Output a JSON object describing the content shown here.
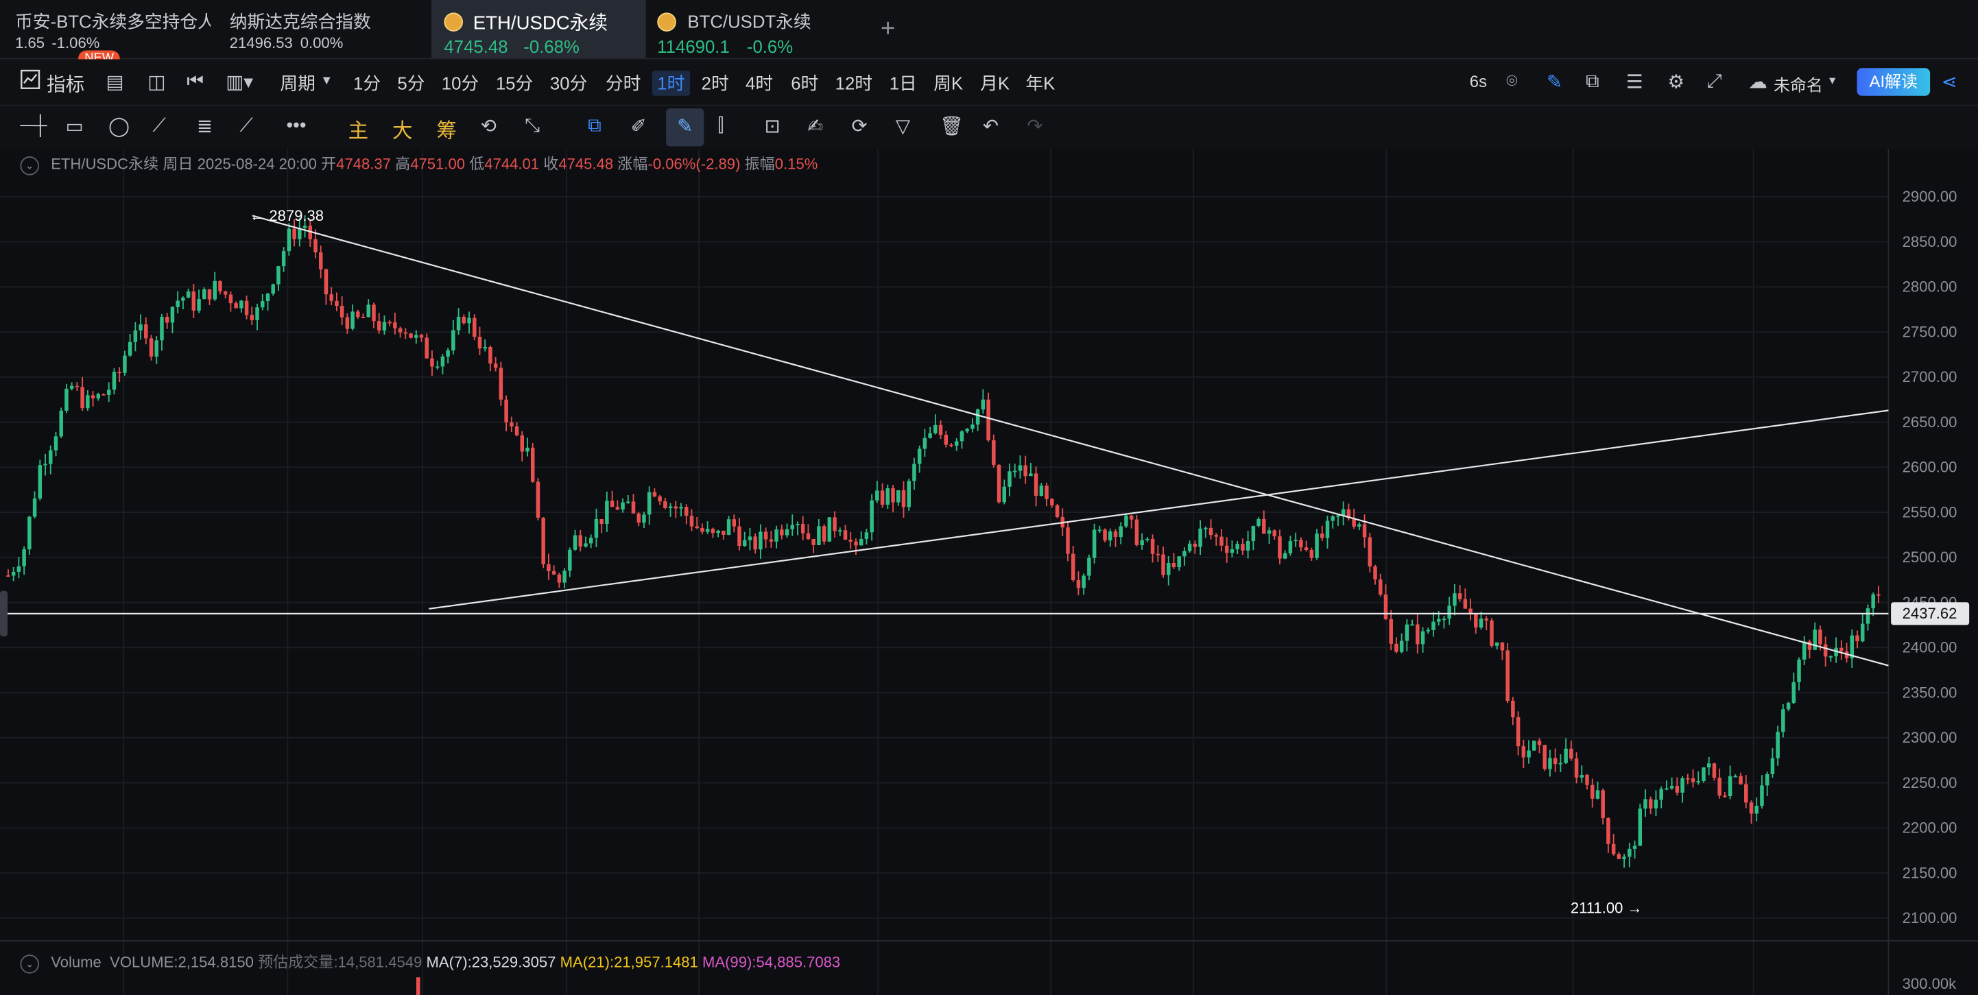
{
  "tabs": [
    {
      "title": "币安-BTC永续多空持仓人数",
      "price": "1.65",
      "change": "-1.06%",
      "badge": "NEW"
    },
    {
      "title": "纳斯达克综合指数",
      "price": "21496.53",
      "change": "0.00%"
    },
    {
      "title": "ETH/USDC永续",
      "price": "4745.48",
      "change": "-0.68%",
      "active": true
    },
    {
      "title": "BTC/USDT永续",
      "price": "114690.1",
      "change": "-0.6%"
    }
  ],
  "toolbar": {
    "indicator": "指标",
    "period": "周期",
    "intervals": [
      "1分",
      "5分",
      "10分",
      "15分",
      "30分",
      "分时",
      "1时",
      "2时",
      "4时",
      "6时",
      "12时",
      "1日",
      "周K",
      "月K",
      "年K"
    ],
    "selected_interval": "1时",
    "refresh": "6s",
    "layout_name": "未命名",
    "ai_label": "AI解读"
  },
  "drawing_tools": {
    "main": "主",
    "big": "大",
    "chips": "筹"
  },
  "legend": {
    "symbol": "ETH/USDC永续",
    "period": "周日",
    "datetime": "2025-08-24 20:00",
    "open_label": "开",
    "open": "4748.37",
    "high_label": "高",
    "high": "4751.00",
    "low_label": "低",
    "low": "4744.01",
    "close_label": "收",
    "close": "4745.48",
    "chg_label": "涨幅",
    "chg": "-0.06%(-2.89)",
    "amp_label": "振幅",
    "amp": "0.15%"
  },
  "volume_legend": {
    "title": "Volume",
    "volume": "VOLUME:2,154.8150",
    "estimate": "预估成交量:14,581.4549",
    "ma7": "MA(7):23,529.3057",
    "ma21": "MA(21):21,957.1481",
    "ma99": "MA(99):54,885.7083"
  },
  "chart_data": {
    "type": "candlestick",
    "y_ticks": [
      "2900.00",
      "2850.00",
      "2800.00",
      "2750.00",
      "2700.00",
      "2650.00",
      "2600.00",
      "2550.00",
      "2500.00",
      "2450.00",
      "2400.00",
      "2350.00",
      "2300.00",
      "2250.00",
      "2200.00",
      "2150.00",
      "2100.00"
    ],
    "ylim": [
      2080,
      2920
    ],
    "volume_tick": "300.00k",
    "current_price": "2437.62",
    "high_annotation": "2879.38",
    "low_annotation": "2111.00",
    "close_path": [
      2480,
      2510,
      2600,
      2640,
      2690,
      2670,
      2680,
      2700,
      2760,
      2730,
      2770,
      2790,
      2780,
      2800,
      2790,
      2780,
      2770,
      2820,
      2860,
      2870,
      2800,
      2770,
      2760,
      2770,
      2750,
      2760,
      2740,
      2720,
      2730,
      2770,
      2740,
      2700,
      2640,
      2620,
      2500,
      2470,
      2520,
      2530,
      2550,
      2560,
      2540,
      2580,
      2560,
      2550,
      2530,
      2520,
      2540,
      2510,
      2520,
      2530,
      2550,
      2520,
      2530,
      2540,
      2500,
      2560,
      2570,
      2560,
      2620,
      2640,
      2630,
      2650,
      2670,
      2560,
      2600,
      2590,
      2560,
      2530,
      2470,
      2520,
      2530,
      2540,
      2520,
      2500,
      2480,
      2510,
      2530,
      2520,
      2510,
      2520,
      2540,
      2500,
      2520,
      2510,
      2530,
      2550,
      2540,
      2480,
      2400,
      2420,
      2410,
      2440,
      2450,
      2440,
      2420,
      2400,
      2280,
      2290,
      2270,
      2280,
      2260,
      2240,
      2180,
      2160,
      2220,
      2240,
      2240,
      2250,
      2270,
      2240,
      2270,
      2210,
      2260,
      2330,
      2400,
      2410,
      2390,
      2400,
      2420,
      2470
    ],
    "trendlines": [
      {
        "from": [
          200,
          2879
        ],
        "to": [
          1497,
          2380
        ]
      },
      {
        "from": [
          340,
          2443
        ],
        "to": [
          1497,
          2663
        ]
      }
    ],
    "horizontal_line": 2437.62
  }
}
